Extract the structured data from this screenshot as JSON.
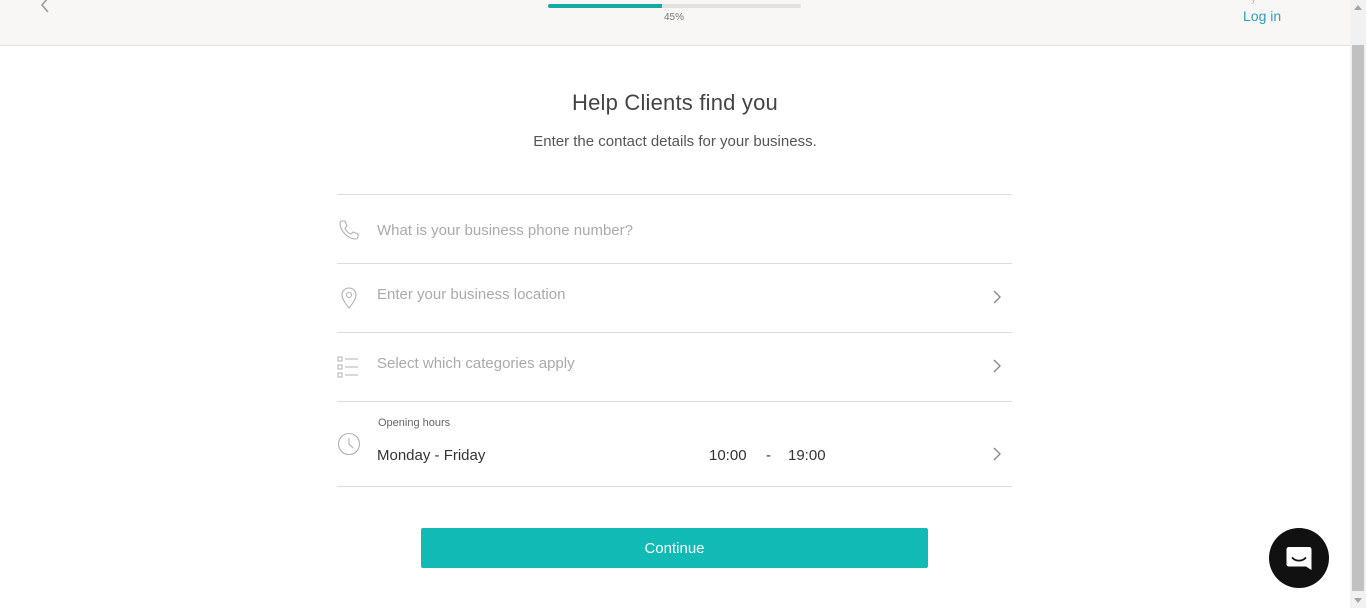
{
  "header": {
    "back_icon": "chevron-left-icon",
    "progress_value": 0.45,
    "progress_label": "45%",
    "login_label": "Log in",
    "accent_color": "#2aa1b8"
  },
  "main": {
    "title": "Help Clients find you",
    "subtitle": "Enter the contact details for your business."
  },
  "form": {
    "phone": {
      "icon": "phone-icon",
      "placeholder": "What is your business phone number?",
      "value": ""
    },
    "location": {
      "icon": "location-pin-icon",
      "placeholder": "Enter your business location"
    },
    "categories": {
      "icon": "list-icon",
      "placeholder": "Select which categories apply"
    },
    "hours": {
      "icon": "clock-icon",
      "label": "Opening hours",
      "days": "Monday - Friday",
      "open": "10:00",
      "separator": "-",
      "close": "19:00"
    }
  },
  "actions": {
    "continue_label": "Continue",
    "button_color": "#12bab6"
  },
  "chat": {
    "icon": "chat-icon"
  }
}
